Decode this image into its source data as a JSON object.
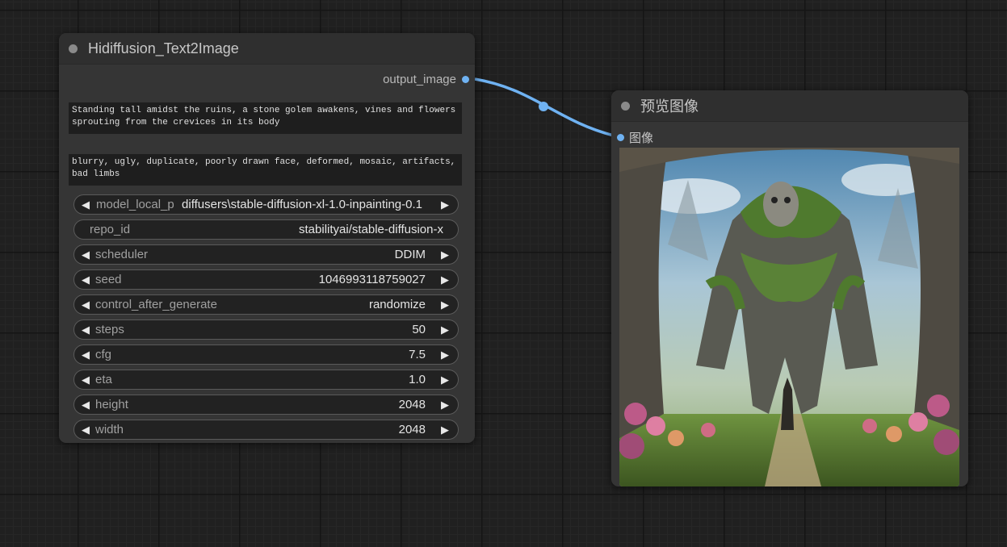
{
  "left_node": {
    "title": "Hidiffusion_Text2Image",
    "output_label": "output_image",
    "positive_prompt": "Standing tall amidst the ruins, a stone golem awakens, vines and flowers\nsprouting from the crevices in its body",
    "negative_prompt": "blurry, ugly, duplicate, poorly drawn face, deformed, mosaic, artifacts,\nbad limbs",
    "widgets": [
      {
        "label": "model_local_p",
        "value": "diffusers\\stable-diffusion-xl-1.0-inpainting-0.1",
        "arrows": true
      },
      {
        "label": "repo_id",
        "value": "stabilityai/stable-diffusion-x",
        "arrows": false
      },
      {
        "label": "scheduler",
        "value": "DDIM",
        "arrows": true
      },
      {
        "label": "seed",
        "value": "1046993118759027",
        "arrows": true
      },
      {
        "label": "control_after_generate",
        "value": "randomize",
        "arrows": true
      },
      {
        "label": "steps",
        "value": "50",
        "arrows": true
      },
      {
        "label": "cfg",
        "value": "7.5",
        "arrows": true
      },
      {
        "label": "eta",
        "value": "1.0",
        "arrows": true
      },
      {
        "label": "height",
        "value": "2048",
        "arrows": true
      },
      {
        "label": "width",
        "value": "2048",
        "arrows": true
      }
    ]
  },
  "right_node": {
    "title": "预览图像",
    "input_label": "图像"
  },
  "colors": {
    "link": "#6fb2f2",
    "canvas": "#202020",
    "node_body": "#353535"
  },
  "icons": {
    "widget_decrement": "left-triangle-icon",
    "widget_increment": "right-triangle-icon"
  }
}
